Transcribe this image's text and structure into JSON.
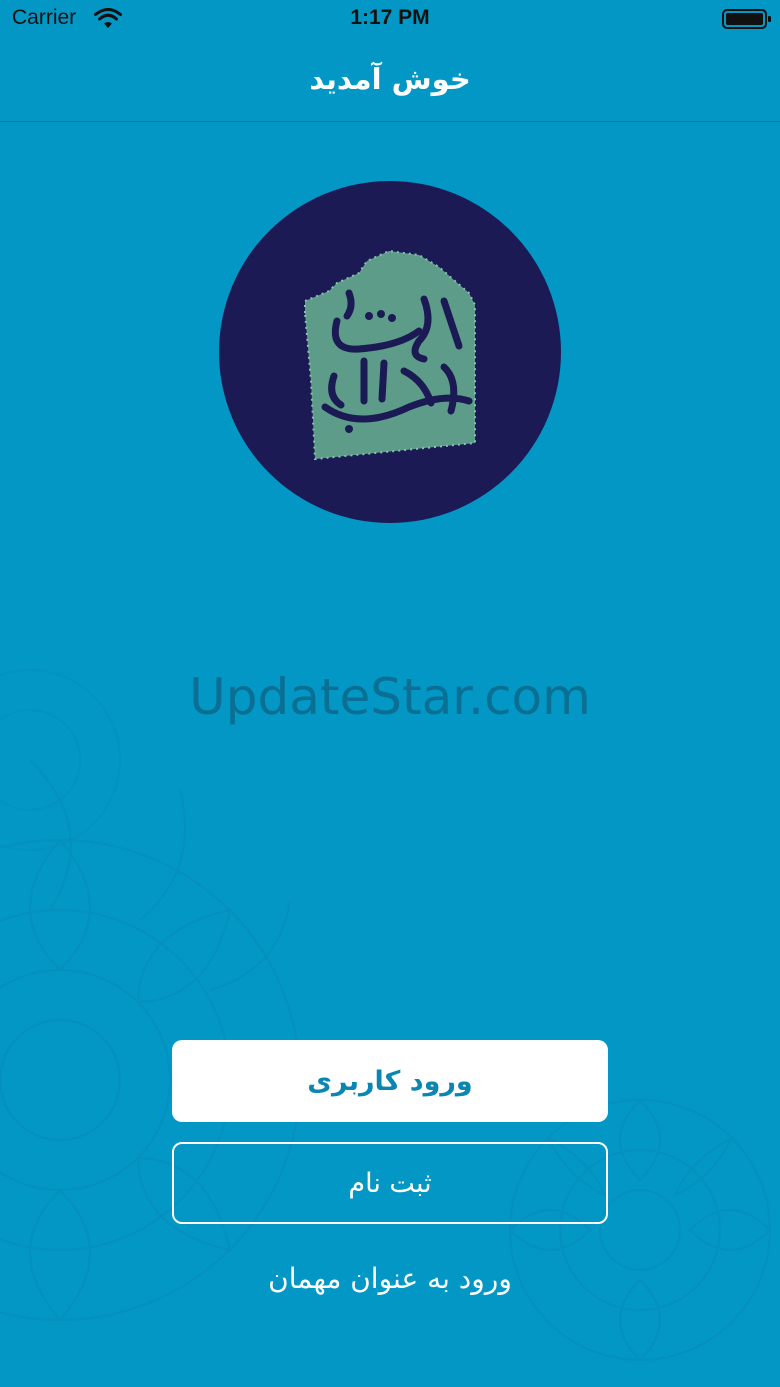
{
  "status_bar": {
    "carrier": "Carrier",
    "time": "1:17 PM",
    "wifi_icon": "wifi-icon",
    "battery_icon": "battery-full-icon"
  },
  "nav": {
    "title": "خوش آمدید"
  },
  "logo": {
    "calligraphy_text": "سروش عبدالکریم",
    "circle_color": "#1c1a55",
    "badge_color": "#5e9c8a"
  },
  "watermark": {
    "text": "UpdateStar.com"
  },
  "actions": {
    "login_label": "ورود کاربری",
    "register_label": "ثبت نام",
    "guest_label": "ورود به عنوان مهمان"
  },
  "colors": {
    "background": "#0297c5",
    "login_text": "#0a86b0",
    "button_bg": "#ffffff"
  }
}
